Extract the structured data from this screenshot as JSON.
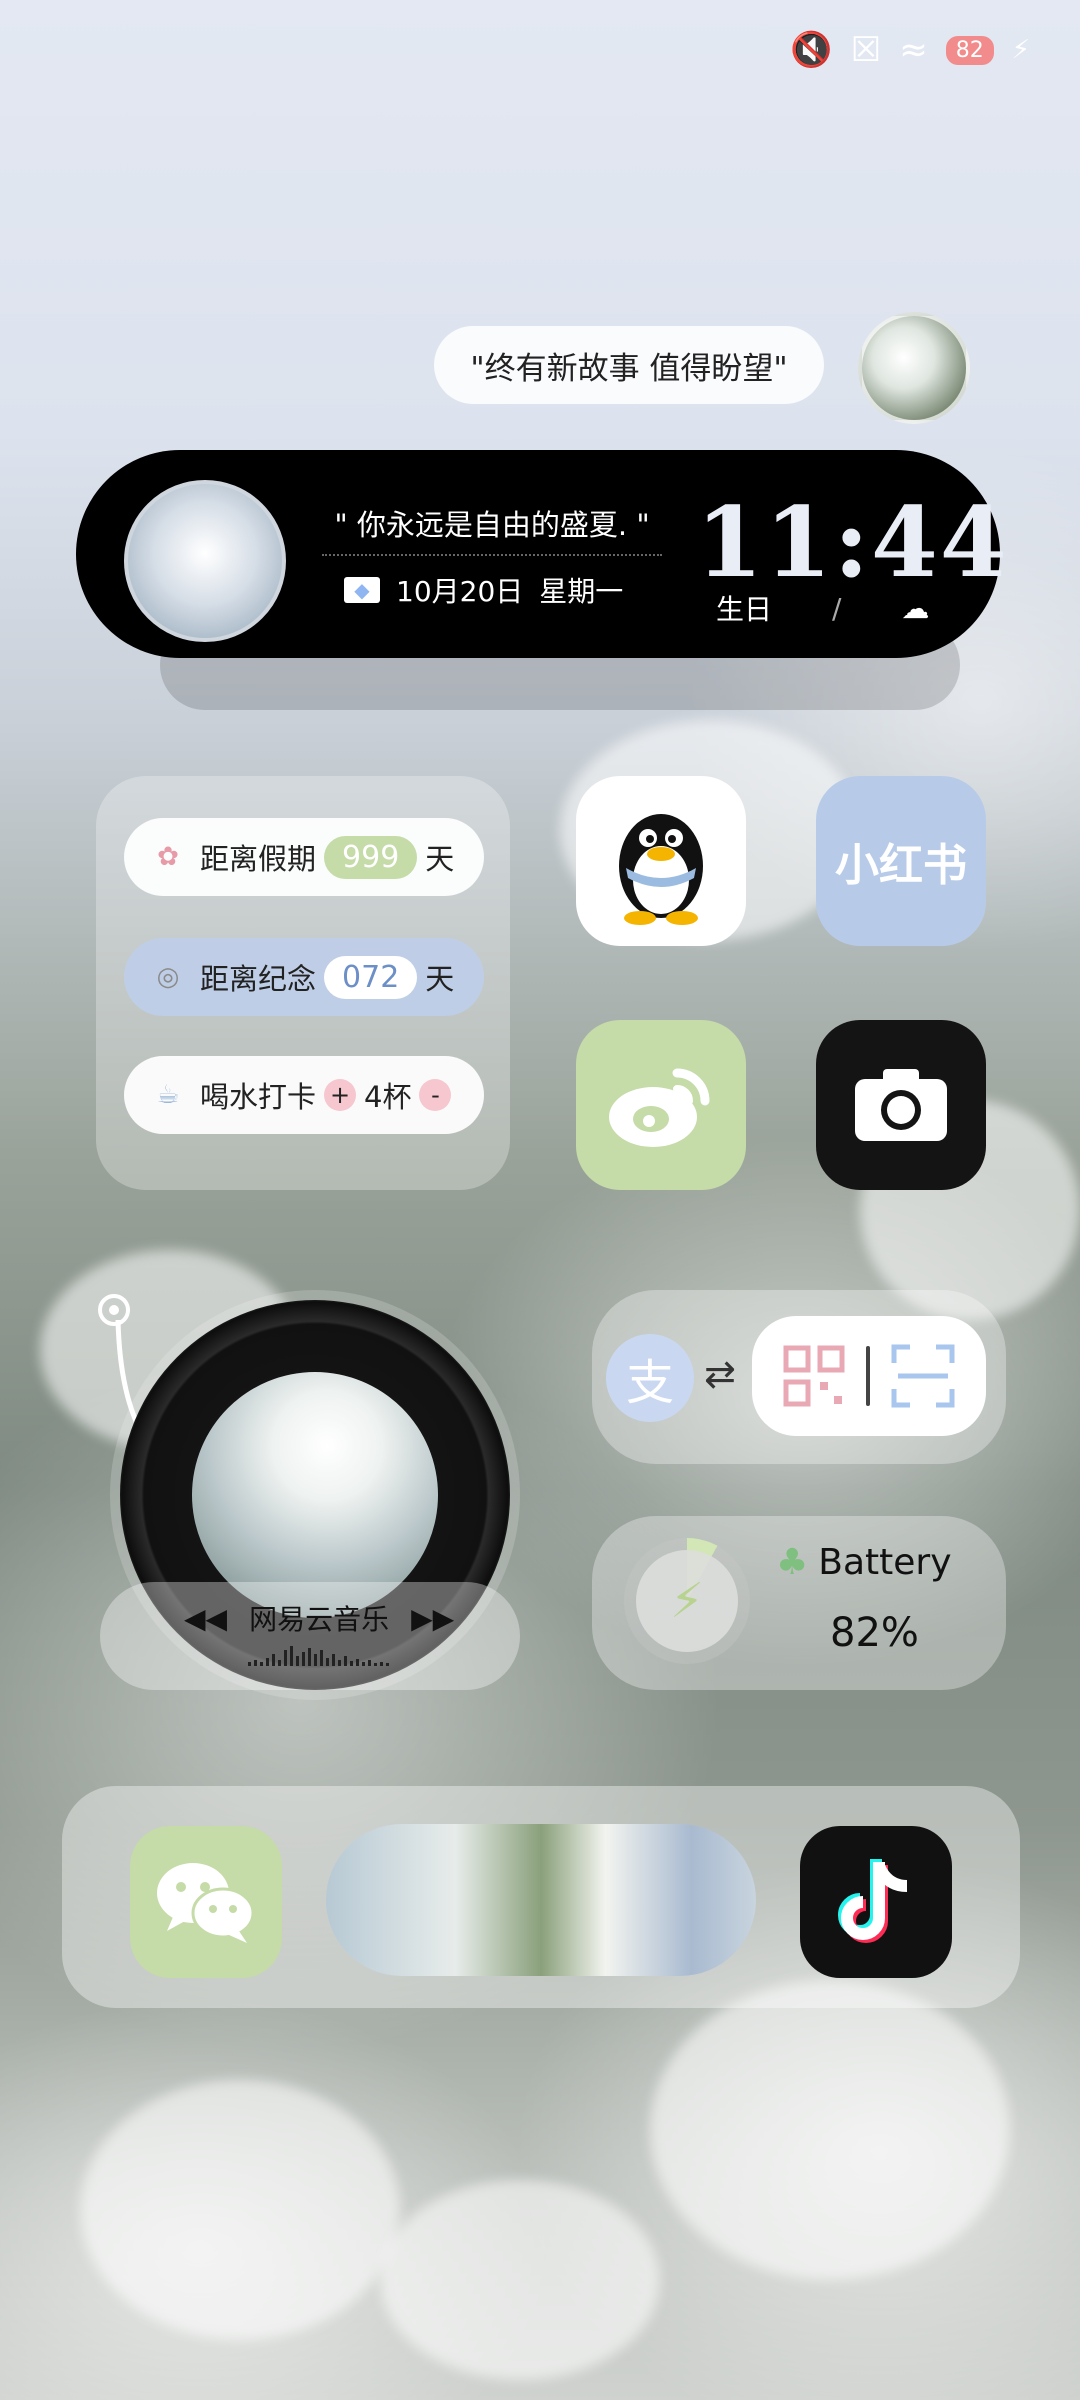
{
  "status": {
    "battery_level": "82"
  },
  "quote_widget": {
    "text": "\"终有新故事 值得盼望\""
  },
  "clock_widget": {
    "quote": "\" 你永远是自由的盛夏. \"",
    "date": "10月20日",
    "weekday": "星期一",
    "time": "11:44",
    "label_birthday": "生日",
    "separator": "/"
  },
  "countdown_widget": {
    "rows": [
      {
        "label": "距离假期",
        "value": "999",
        "unit": "天"
      },
      {
        "label": "距离纪念",
        "value": "072",
        "unit": "天"
      }
    ],
    "water": {
      "label": "喝水打卡",
      "plus": "+",
      "count": "4杯",
      "minus": "-"
    }
  },
  "apps": {
    "xiaohongshu_label": "小红书"
  },
  "music_widget": {
    "app_name": "网易云音乐"
  },
  "battery_widget": {
    "title": "Battery",
    "value": "82%",
    "level_fraction": 0.82
  },
  "colors": {
    "accent_green": "#c5dba8",
    "accent_blue": "#b7cbe9",
    "accent_pink": "#f4c7cf"
  }
}
